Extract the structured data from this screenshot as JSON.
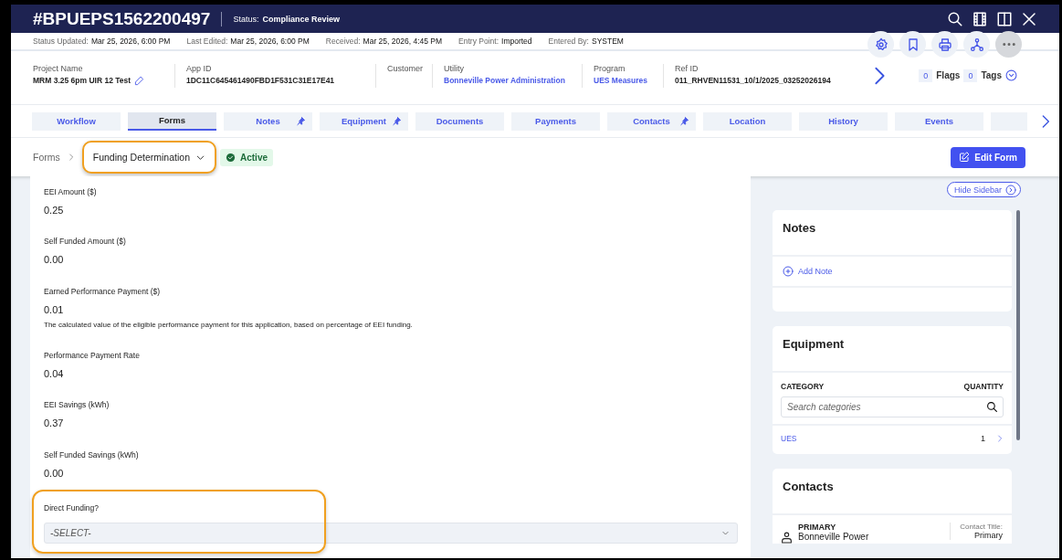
{
  "header": {
    "record_id": "#BPUEPS1562200497",
    "status_label": "Status:",
    "status": "Compliance Review"
  },
  "meta": [
    {
      "label": "Status Updated:",
      "value": "Mar 25, 2026, 6:00 PM"
    },
    {
      "label": "Last Edited:",
      "value": "Mar 25, 2026, 6:00 PM"
    },
    {
      "label": "Received:",
      "value": "Mar 25, 2026, 4:45 PM"
    },
    {
      "label": "Entry Point:",
      "value": "Imported"
    },
    {
      "label": "Entered By:",
      "value": "SYSTEM"
    }
  ],
  "info": [
    {
      "label": "Project Name",
      "value": "MRM 3.25 6pm UIR 12 Test",
      "kind": "editable"
    },
    {
      "label": "App ID",
      "value": "1DC11C645461490FBD1F531C31E17E41",
      "kind": "plain"
    },
    {
      "label": "Customer"
    },
    {
      "label": "Utility",
      "value": "Bonneville Power Administration",
      "kind": "link"
    },
    {
      "label": "Program",
      "value": "UES Measures",
      "kind": "link"
    },
    {
      "label": "Ref ID",
      "value": "011_RHVEN11531_10/1/2025_03252026194",
      "kind": "plain"
    }
  ],
  "counters": [
    {
      "count": "0",
      "label": "Flags"
    },
    {
      "count": "0",
      "label": "Tags"
    }
  ],
  "tabs": [
    {
      "label": "Workflow",
      "selected": false,
      "pinned": false
    },
    {
      "label": "Forms",
      "selected": true,
      "pinned": false
    },
    {
      "label": "Notes",
      "selected": false,
      "pinned": true
    },
    {
      "label": "Equipment",
      "selected": false,
      "pinned": true
    },
    {
      "label": "Documents",
      "selected": false,
      "pinned": false
    },
    {
      "label": "Payments",
      "selected": false,
      "pinned": false
    },
    {
      "label": "Contacts",
      "selected": false,
      "pinned": true
    },
    {
      "label": "Location",
      "selected": false,
      "pinned": false
    },
    {
      "label": "History",
      "selected": false,
      "pinned": false
    },
    {
      "label": "Events",
      "selected": false,
      "pinned": false
    },
    {
      "selected": false,
      "pinned": false
    }
  ],
  "breadcrumb": {
    "root": "Forms",
    "current": "Funding Determination",
    "highlighted": true,
    "status": "Active"
  },
  "edit_button": "Edit Form",
  "fields": [
    {
      "label": "EEI Amount ($)",
      "value": "0.25"
    },
    {
      "label": "Self Funded Amount ($)",
      "value": "0.00"
    },
    {
      "label": "Earned Performance Payment ($)",
      "value": "0.01",
      "help": "The calculated value of the eligible performance payment for this application, based on percentage of EEI funding."
    },
    {
      "label": "Performance Payment Rate",
      "value": "0.04"
    },
    {
      "label": "EEI Savings (kWh)",
      "value": "0.37"
    },
    {
      "label": "Self Funded Savings (kWh)",
      "value": "0.00"
    }
  ],
  "direct_funding": {
    "label": "Direct Funding?",
    "placeholder": "-SELECT-",
    "highlighted": true
  },
  "sidebar": {
    "hide_label": "Hide Sidebar",
    "notes": {
      "title": "Notes",
      "add_label": "Add Note"
    },
    "equipment": {
      "title": "Equipment",
      "columns": [
        "CATEGORY",
        "QUANTITY"
      ],
      "search_placeholder": "Search categories",
      "rows": [
        {
          "category": "UES",
          "quantity": "1"
        }
      ]
    },
    "contacts": {
      "title": "Contacts",
      "items": [
        {
          "role": "PRIMARY",
          "name": "Bonneville Power",
          "title_label": "Contact Title:",
          "title": "Primary"
        }
      ]
    }
  }
}
